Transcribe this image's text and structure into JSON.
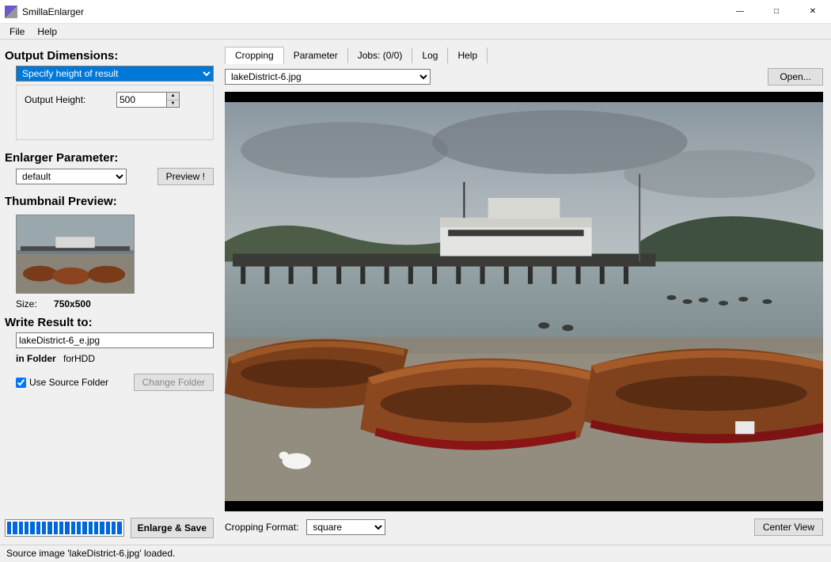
{
  "window": {
    "title": "SmillaEnlarger"
  },
  "menu": {
    "file": "File",
    "help": "Help"
  },
  "left": {
    "output_dimensions_label": "Output Dimensions:",
    "dimension_mode": "Specify height of result",
    "output_height_label": "Output Height:",
    "output_height_value": "500",
    "enlarger_parameter_label": "Enlarger Parameter:",
    "parameter_preset": "default",
    "preview_button": "Preview !",
    "thumbnail_preview_label": "Thumbnail Preview:",
    "size_label": "Size:",
    "size_value": "750x500",
    "write_result_label": "Write Result to:",
    "result_filename": "lakeDistrict-6_e.jpg",
    "in_folder_label": "in Folder",
    "in_folder_value": "forHDD",
    "use_source_folder_label": "Use Source Folder",
    "use_source_folder_checked": true,
    "change_folder_button": "Change Folder",
    "enlarge_save_button": "Enlarge & Save"
  },
  "tabs": {
    "cropping": "Cropping",
    "parameter": "Parameter",
    "jobs": "Jobs: (0/0)",
    "log": "Log",
    "help": "Help"
  },
  "right": {
    "current_file": "lakeDistrict-6.jpg",
    "open_button": "Open...",
    "cropping_format_label": "Cropping Format:",
    "cropping_format_value": "square",
    "center_view_button": "Center View"
  },
  "status": {
    "message": "Source image 'lakeDistrict-6.jpg' loaded."
  }
}
